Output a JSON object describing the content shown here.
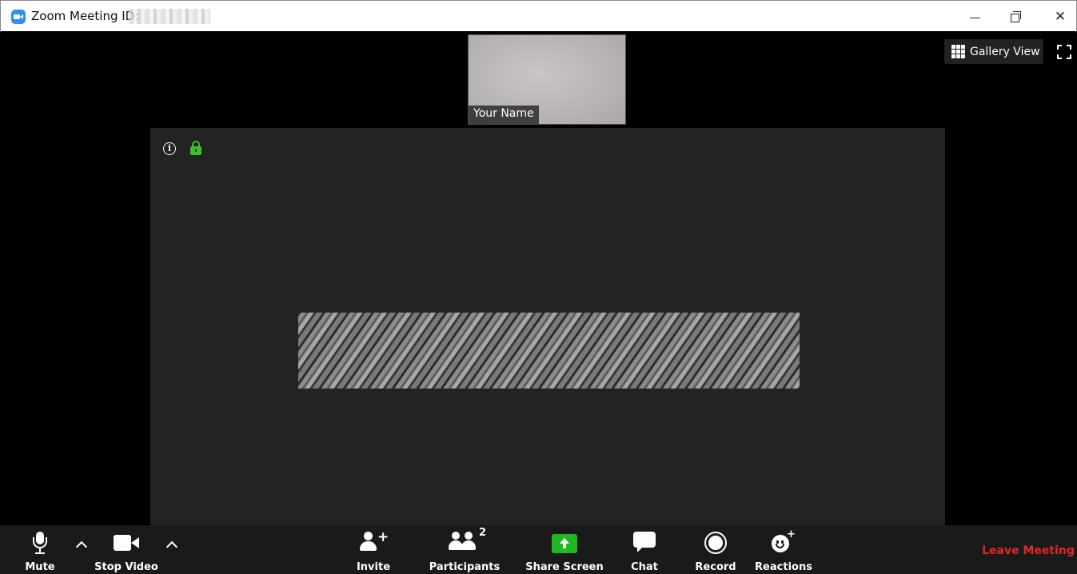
{
  "window": {
    "title": "Zoom Meeting ID:",
    "controls": {
      "minimize": "minimize",
      "restore": "restore",
      "close": "close"
    }
  },
  "self_video": {
    "name": "Your Name"
  },
  "view": {
    "gallery_label": "Gallery View"
  },
  "toolbar": {
    "mute_label": "Mute",
    "stop_video_label": "Stop Video",
    "invite_label": "Invite",
    "participants_label": "Participants",
    "participants_count": "2",
    "share_screen_label": "Share Screen",
    "chat_label": "Chat",
    "record_label": "Record",
    "reactions_label": "Reactions",
    "leave_label": "Leave Meeting"
  },
  "colors": {
    "accent_blue": "#2d8cff",
    "share_green": "#22b725",
    "lock_green": "#3fbf2b",
    "leave_red": "#e02828",
    "toolbar_bg": "#1a1a1a",
    "stage_bg": "#232323"
  },
  "icons": {
    "app": "zoom-app-icon",
    "info": "info-icon",
    "lock": "lock-icon",
    "gallery": "grid-icon",
    "fullscreen": "fullscreen-icon"
  }
}
